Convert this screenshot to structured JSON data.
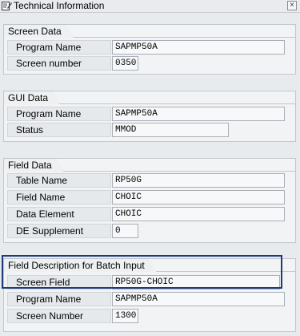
{
  "window": {
    "title": "Technical Information",
    "close_glyph": "×"
  },
  "screen_data": {
    "title": "Screen Data",
    "program_name_label": "Program Name",
    "program_name_value": "SAPMP50A",
    "screen_number_label": "Screen number",
    "screen_number_value": "0350"
  },
  "gui_data": {
    "title": "GUI Data",
    "program_name_label": "Program Name",
    "program_name_value": "SAPMP50A",
    "status_label": "Status",
    "status_value": "MMOD"
  },
  "field_data": {
    "title": "Field Data",
    "table_name_label": "Table Name",
    "table_name_value": "RP50G",
    "field_name_label": "Field Name",
    "field_name_value": "CHOIC",
    "data_element_label": "Data Element",
    "data_element_value": "CHOIC",
    "de_supplement_label": "DE Supplement",
    "de_supplement_value": "0"
  },
  "batch_input": {
    "title": "Field Description for Batch Input",
    "screen_field_label": "Screen Field",
    "screen_field_value": "RP50G-CHOIC",
    "program_name_label": "Program Name",
    "program_name_value": "SAPMP50A",
    "screen_number_label": "Screen Number",
    "screen_number_value": "1300"
  }
}
